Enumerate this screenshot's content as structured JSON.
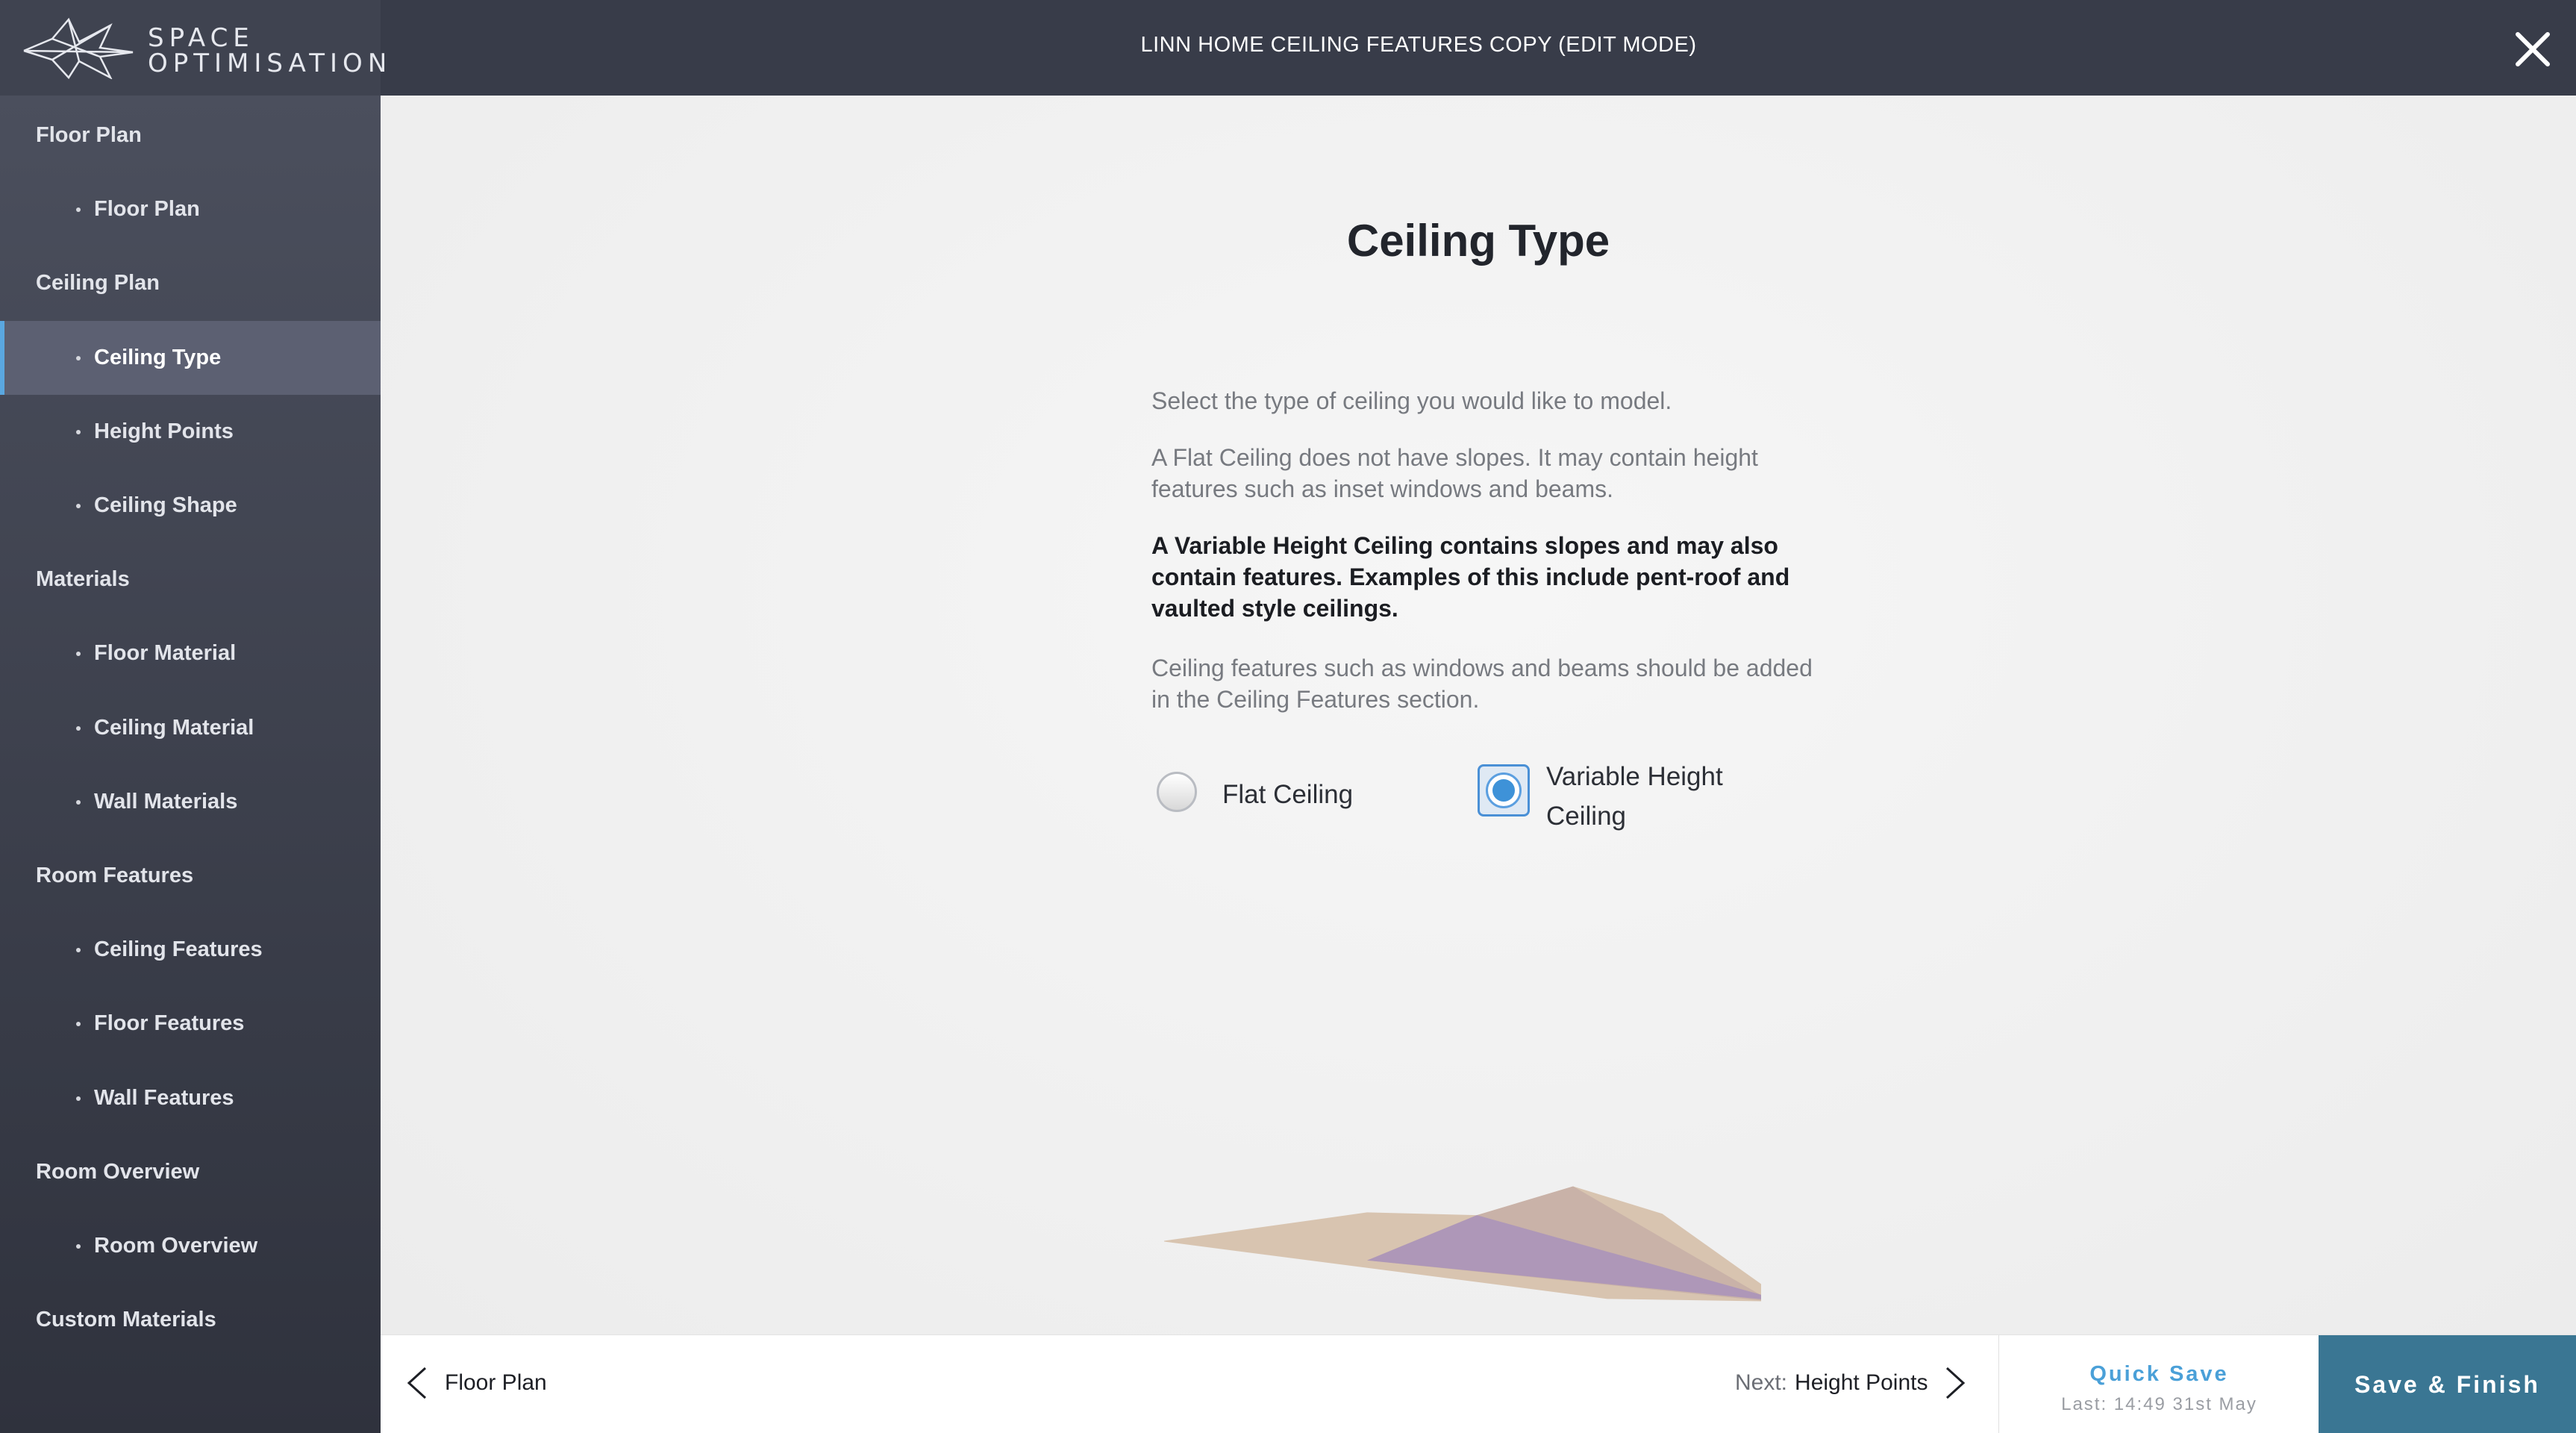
{
  "app": {
    "logo_line1": "SPACE",
    "logo_line2": "OPTIMISATION",
    "title": "LINN HOME CEILING FEATURES COPY (EDIT MODE)"
  },
  "sidebar": {
    "items": [
      {
        "label": "Floor Plan",
        "kind": "section"
      },
      {
        "label": "Floor Plan",
        "kind": "sub"
      },
      {
        "label": "Ceiling Plan",
        "kind": "section"
      },
      {
        "label": "Ceiling Type",
        "kind": "sub",
        "active": true
      },
      {
        "label": "Height Points",
        "kind": "sub"
      },
      {
        "label": "Ceiling Shape",
        "kind": "sub"
      },
      {
        "label": "Materials",
        "kind": "section"
      },
      {
        "label": "Floor Material",
        "kind": "sub"
      },
      {
        "label": "Ceiling Material",
        "kind": "sub"
      },
      {
        "label": "Wall Materials",
        "kind": "sub"
      },
      {
        "label": "Room Features",
        "kind": "section"
      },
      {
        "label": "Ceiling Features",
        "kind": "sub"
      },
      {
        "label": "Floor Features",
        "kind": "sub"
      },
      {
        "label": "Wall Features",
        "kind": "sub"
      },
      {
        "label": "Room Overview",
        "kind": "section"
      },
      {
        "label": "Room Overview",
        "kind": "sub"
      },
      {
        "label": "Custom Materials",
        "kind": "section"
      }
    ]
  },
  "main": {
    "heading": "Ceiling Type",
    "intro": "Select the type of ceiling you would like to model.",
    "flat_desc": "A Flat Ceiling does not have slopes. It may contain height features such as inset windows and beams.",
    "variable_desc": "A Variable Height Ceiling contains slopes and may also contain features. Examples of this include pent-roof and vaulted style ceilings.",
    "features_note": "Ceiling features such as windows and beams should be added in the Ceiling Features section.",
    "options": {
      "flat": "Flat Ceiling",
      "variable_line1": "Variable Height",
      "variable_line2": "Ceiling",
      "selected": "variable"
    }
  },
  "footer": {
    "prev_label": "Floor Plan",
    "next_prefix": "Next:",
    "next_label": "Height Points",
    "quick_save": "Quick Save",
    "last_saved": "Last: 14:49 31st May",
    "save_finish": "Save & Finish"
  },
  "colors": {
    "topbar": "#383c49",
    "accent": "#4aa0d8",
    "save_button": "#3a7693",
    "active_indicator": "#5aa7e0"
  }
}
